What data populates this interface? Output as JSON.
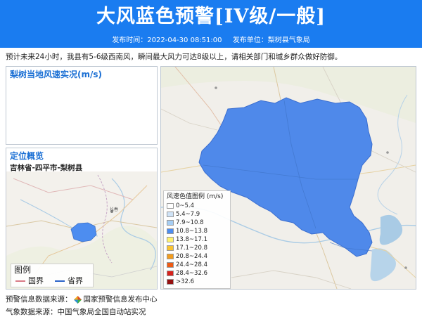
{
  "header": {
    "title": "大风蓝色预警[IV级/一般]",
    "publish_time_label": "发布时间：2022-04-30 08:51:00",
    "publisher_label": "发布单位：梨树县气象局"
  },
  "notice": "预计未来24小时，我县有5-6级西南风，瞬间最大风力可达8级以上，请相关部门和城乡群众做好防御。",
  "wind_panel": {
    "title": "梨树当地风速实况(m/s)"
  },
  "locate_panel": {
    "title": "定位概览",
    "region": "吉林省-四平市-梨树县",
    "map_labels": {
      "city": "长春"
    },
    "legend": {
      "title": "图例",
      "national": "国界",
      "provincial": "省界"
    }
  },
  "legend": {
    "title": "风速色值图例 (m/s)",
    "items": [
      {
        "label": "0~5.4",
        "color": "#ffffff"
      },
      {
        "label": "5.4~7.9",
        "color": "#cfe3f7"
      },
      {
        "label": "7.9~10.8",
        "color": "#a5cdf3"
      },
      {
        "label": "10.8~13.8",
        "color": "#4d8df0"
      },
      {
        "label": "13.8~17.1",
        "color": "#fff26e"
      },
      {
        "label": "17.1~20.8",
        "color": "#f9c332"
      },
      {
        "label": "20.8~24.4",
        "color": "#f29c1e"
      },
      {
        "label": "24.4~28.4",
        "color": "#ee5a13"
      },
      {
        "label": "28.4~32.6",
        "color": "#d7231d"
      },
      {
        "label": ">32.6",
        "color": "#961010"
      }
    ]
  },
  "footer": {
    "source_label": "预警信息数据来源：",
    "source_name": "国家预警信息发布中心",
    "weather_source": "气象数据来源：中国气象局全国自动站实况"
  },
  "colors": {
    "banner": "#1a7cf0",
    "warning_area": "#4f89ea",
    "accent_text": "#1a6fd4"
  }
}
